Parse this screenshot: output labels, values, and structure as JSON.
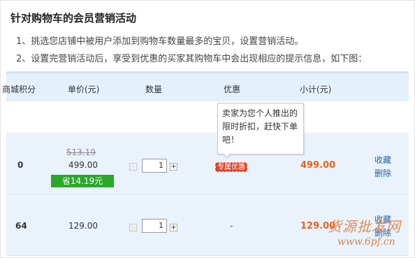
{
  "header": {
    "title": "针对购物车的会员营销活动",
    "desc1": "1、挑选您店铺中被用户添加到购物车数量最多的宝贝，设置营销活动。",
    "desc2": "2、设置完营销活动后，享受到优惠的买家其购物车中会出现相应的提示信息，如下图："
  },
  "table": {
    "columns": [
      "商城积分",
      "单价(元)",
      "数量",
      "优惠",
      "小计(元)"
    ],
    "rows": [
      {
        "points": "0",
        "old_price": "513.19",
        "price": "499.00",
        "save_label": "省14.19元",
        "qty_minus": "-",
        "qty": "1",
        "qty_plus": "+",
        "promo": "专属优惠",
        "subtotal": "499.00",
        "action1": "收藏",
        "action2": "删除"
      },
      {
        "points": "64",
        "price": "129.00",
        "qty_minus": "-",
        "qty": "1",
        "qty_plus": "+",
        "promo": "-",
        "subtotal": "129.00",
        "action1": "收藏",
        "action2": "删除"
      }
    ]
  },
  "tooltip": {
    "line1": "卖家为您个人推出的",
    "line2": "限时折扣，赶快下单",
    "line3": "吧！"
  },
  "watermark": {
    "text": "货源批发网",
    "url": "www.6pf.cn"
  },
  "colors": {
    "header_bg": "#e4f1fb",
    "row_bg": "#eaf3fb",
    "save_badge": "#2aa82a",
    "promo_tag": "#d9452b",
    "subtotal": "#e8641b",
    "link": "#2a62a8"
  }
}
